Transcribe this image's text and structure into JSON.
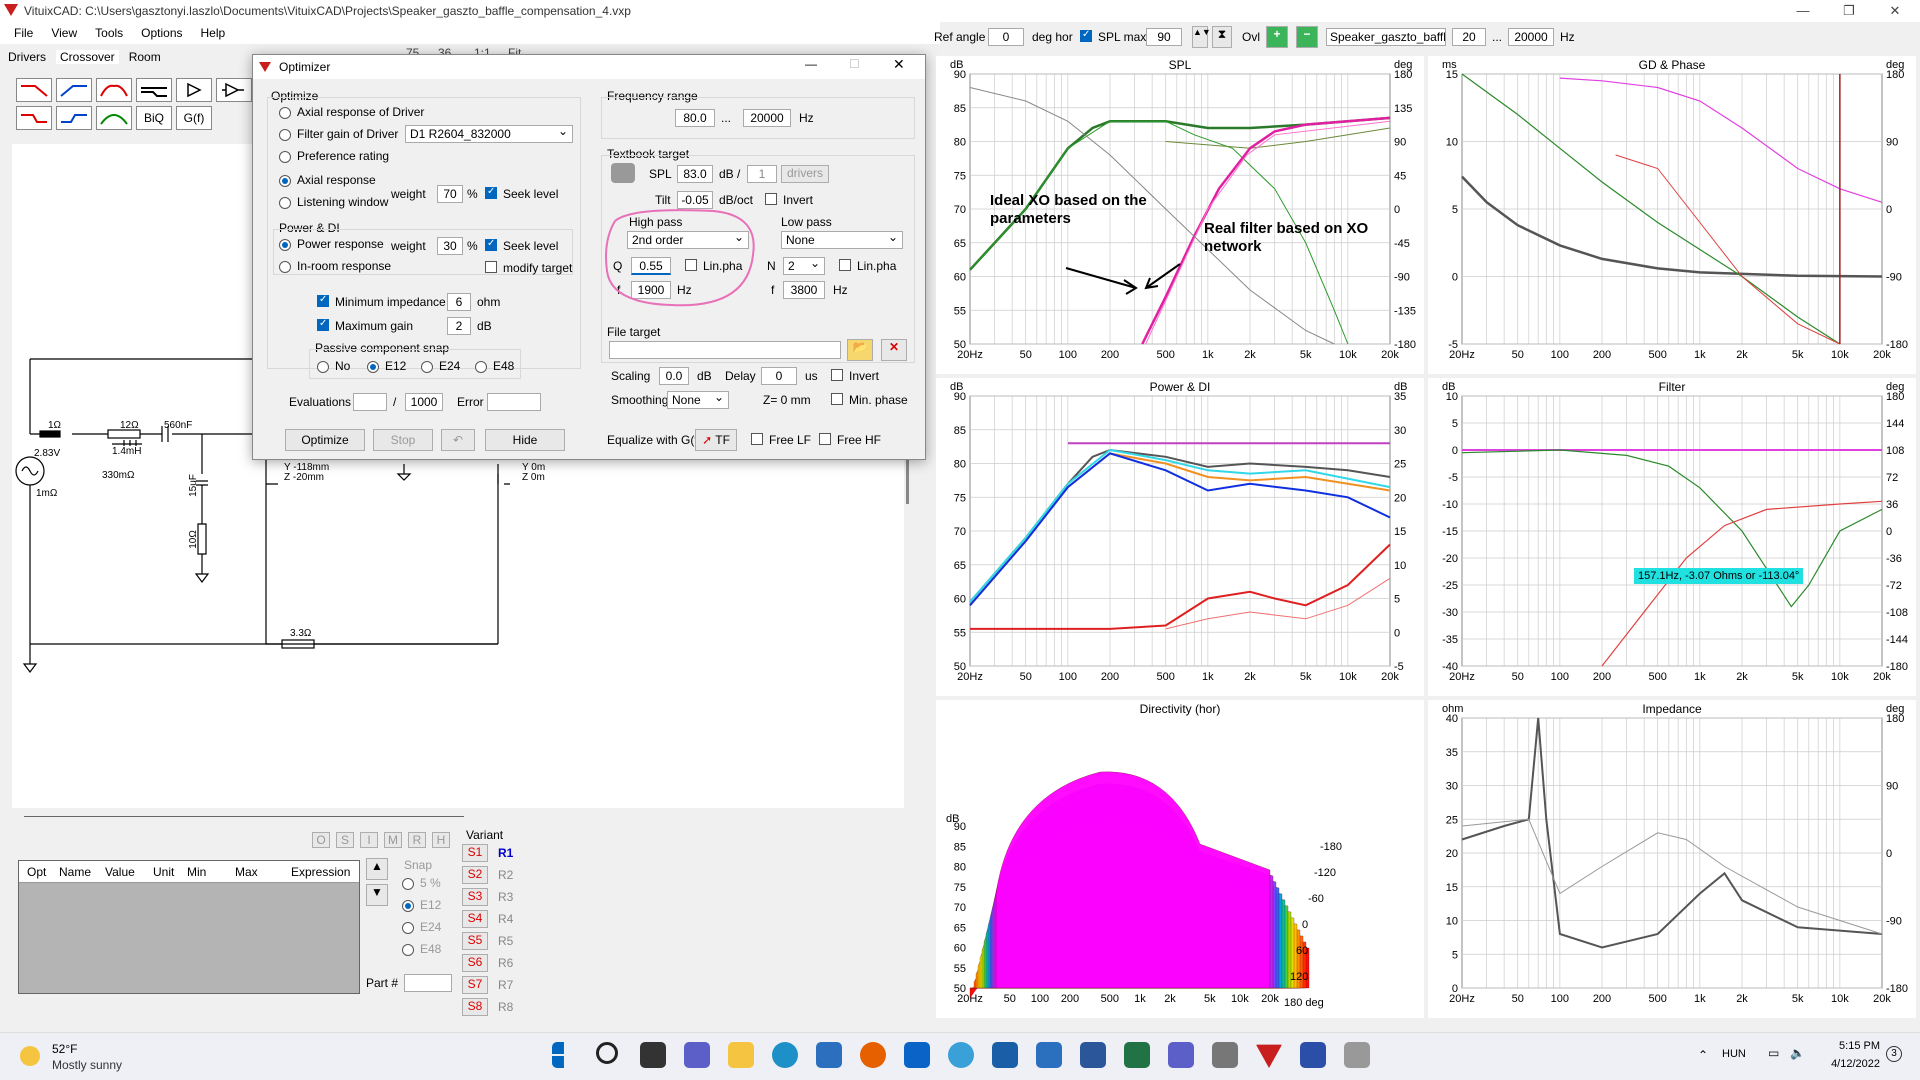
{
  "app": {
    "title": "VituixCAD: C:\\Users\\gasztonyi.laszlo\\Documents\\VituixCAD\\Projects\\Speaker_gaszto_baffle_compensation_4.vxp"
  },
  "menu": [
    "File",
    "View",
    "Tools",
    "Options",
    "Help"
  ],
  "main_tabs": [
    "Drivers",
    "Crossover",
    "Room"
  ],
  "toolbar": {
    "biq": "BiQ",
    "gf": "G(f)",
    "zoom_vals": [
      "75",
      "36",
      "1:1",
      "Fit"
    ]
  },
  "schematic": {
    "labels": [
      "1Ω",
      "12Ω",
      "560nF",
      "2.83V",
      "1.4mH",
      "330mΩ",
      "1mΩ",
      "15uF",
      "10Ω",
      "3.3Ω",
      "Y -118mm",
      "Z -20mm",
      "Y 0m",
      "Z 0m"
    ]
  },
  "table": {
    "headers": [
      "Opt",
      "Name",
      "Value",
      "Unit",
      "Min",
      "Max",
      "Expression"
    ],
    "snap_label": "Snap",
    "snap_opts": [
      "5 %",
      "E12",
      "E24",
      "E48"
    ],
    "part_label": "Part #",
    "variant_label": "Variant",
    "s_buttons": [
      "S1",
      "S2",
      "S3",
      "S4",
      "S5",
      "S6",
      "S7",
      "S8"
    ],
    "r_buttons": [
      "R1",
      "R2",
      "R3",
      "R4",
      "R5",
      "R6",
      "R7",
      "R8"
    ],
    "tool_letters": [
      "O",
      "S",
      "I",
      "M",
      "R",
      "H"
    ]
  },
  "optimizer": {
    "title": "Optimizer",
    "optimize_group": "Optimize",
    "opt_items": [
      "Axial response of Driver",
      "Filter gain of Driver",
      "Preference rating",
      "Axial response",
      "Listening window"
    ],
    "driver_select": "D1 R2604_832000",
    "weight_label": "weight",
    "axial_weight": "70",
    "pct": "%",
    "seek_level": "Seek level",
    "power_group": "Power & DI",
    "power_items": [
      "Power response",
      "In-room response"
    ],
    "power_weight": "30",
    "modify_target": "modify target",
    "min_imp_label": "Minimum impedance",
    "min_imp": "6",
    "ohm": "ohm",
    "max_gain_label": "Maximum gain",
    "max_gain": "2",
    "db": "dB",
    "snap_group": "Passive component snap",
    "snap_items": [
      "No",
      "E12",
      "E24",
      "E48"
    ],
    "evaluations_label": "Evaluations",
    "evaluations_max": "1000",
    "error_label": "Error",
    "buttons": {
      "optimize": "Optimize",
      "stop": "Stop",
      "hide": "Hide"
    },
    "freq_group": "Frequency range",
    "freq_lo": "80.0",
    "freq_hi": "20000",
    "hz": "Hz",
    "dots": "...",
    "textbook_group": "Textbook target",
    "spl_label": "SPL",
    "spl": "83.0",
    "db_slash": "dB /",
    "drivers_n": "1",
    "drivers": "drivers",
    "tilt_label": "Tilt",
    "tilt": "-0.05",
    "dboct": "dB/oct",
    "invert": "Invert",
    "hp_label": "High pass",
    "hp_order": "2nd order",
    "q_label": "Q",
    "q_val": "0.55",
    "linpha": "Lin.pha",
    "f_label": "f",
    "hp_f": "1900",
    "lp_label": "Low pass",
    "lp_type": "None",
    "n_label": "N",
    "n_val": "2",
    "lp_f": "3800",
    "file_target": "File target",
    "scaling_label": "Scaling",
    "scaling": "0.0",
    "delay_label": "Delay",
    "delay": "0",
    "us": "us",
    "invert2": "Invert",
    "smoothing_label": "Smoothing",
    "smoothing": "None",
    "z_label": "Z= 0 mm",
    "minphase": "Min. phase",
    "equalize": "Equalize with G(f)",
    "tf": "TF",
    "free_lf": "Free LF",
    "free_hf": "Free HF"
  },
  "top_controls": {
    "ref_angle_label": "Ref angle",
    "ref_angle": "0",
    "deg_hor": "deg hor",
    "spl_max_label": "SPL max",
    "spl_max": "90",
    "ovl": "Ovl",
    "project": "Speaker_gaszto_baffle_",
    "f_lo": "20",
    "dots": "...",
    "f_hi": "20000",
    "hz": "Hz"
  },
  "graphs": {
    "spl": {
      "title": "SPL",
      "unit_l": "dB",
      "unit_r": "deg",
      "y_l": [
        "90",
        "85",
        "80",
        "75",
        "70",
        "65",
        "60",
        "55",
        "50"
      ],
      "y_r": [
        "180",
        "135",
        "90",
        "45",
        "0",
        "-45",
        "-90",
        "-135",
        "-180"
      ],
      "ann1": "Ideal XO based on the parameters",
      "ann2": "Real filter based on  XO network"
    },
    "gd": {
      "title": "GD & Phase",
      "unit_l": "ms",
      "unit_r": "deg",
      "y_l": [
        "15",
        "10",
        "5",
        "0",
        "-5"
      ],
      "y_r": [
        "180",
        "90",
        "0",
        "-90",
        "-180"
      ]
    },
    "pdi": {
      "title": "Power & DI",
      "unit_l": "dB",
      "unit_r": "dB",
      "y_l": [
        "90",
        "85",
        "80",
        "75",
        "70",
        "65",
        "60",
        "55",
        "50"
      ],
      "y_r": [
        "35",
        "30",
        "25",
        "20",
        "15",
        "10",
        "5",
        "0",
        "-5"
      ]
    },
    "filter": {
      "title": "Filter",
      "unit_l": "dB",
      "unit_r": "deg",
      "y_l": [
        "10",
        "5",
        "0",
        "-5",
        "-10",
        "-15",
        "-20",
        "-25",
        "-30",
        "-35",
        "-40"
      ],
      "y_r": [
        "180",
        "144",
        "108",
        "72",
        "36",
        "0",
        "-36",
        "-72",
        "-108",
        "-144",
        "-180"
      ],
      "tooltip": "157.1Hz, -3.07 Ohms or -113.04°"
    },
    "dir": {
      "title": "Directivity (hor)",
      "unit_l": "dB",
      "y_l": [
        "90",
        "85",
        "80",
        "75",
        "70",
        "65",
        "60",
        "55",
        "50"
      ],
      "angles": [
        "-180",
        "-120",
        "-60",
        "0",
        "60",
        "120",
        "180 deg"
      ]
    },
    "imp": {
      "title": "Impedance",
      "unit_l": "ohm",
      "unit_r": "deg",
      "y_l": [
        "40",
        "35",
        "30",
        "25",
        "20",
        "15",
        "10",
        "5",
        "0"
      ],
      "y_r": [
        "180",
        "90",
        "0",
        "-90",
        "-180"
      ]
    },
    "x_ticks": [
      "20Hz",
      "50",
      "100",
      "200",
      "500",
      "1k",
      "2k",
      "5k",
      "10k",
      "20k"
    ]
  },
  "taskbar": {
    "weather_temp": "52°F",
    "weather_desc": "Mostly sunny",
    "lang": "HUN",
    "time": "5:15 PM",
    "date": "4/12/2022",
    "badge": "3"
  }
}
